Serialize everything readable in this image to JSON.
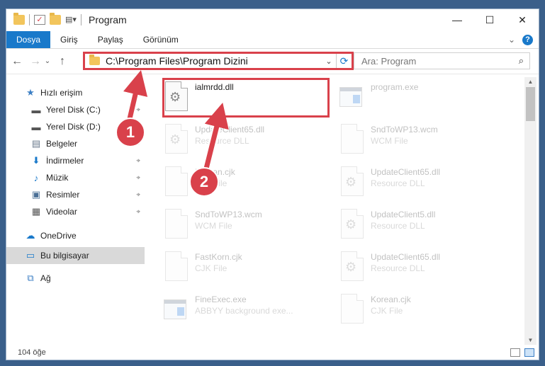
{
  "titlebar": {
    "title": "Program",
    "minimize": "—",
    "maximize": "☐",
    "close": "✕"
  },
  "ribbon": {
    "tabs": [
      "Dosya",
      "Giriş",
      "Paylaş",
      "Görünüm"
    ],
    "expand": "⌄",
    "help": "?"
  },
  "nav": {
    "back": "←",
    "forward": "→",
    "recent": "⌄",
    "up": "↑"
  },
  "address": {
    "path": "C:\\Program Files\\Program Dizini",
    "dropdown": "⌄",
    "refresh": "⟳"
  },
  "search": {
    "placeholder": "Ara: Program",
    "icon": "⌕"
  },
  "sidebar": {
    "items": [
      {
        "label": "Hızlı erişim",
        "icon": "star-icon",
        "glyph": "★",
        "color": "#3c7fc4"
      },
      {
        "label": "Yerel Disk (C:)",
        "icon": "drive-icon",
        "glyph": "▬",
        "color": "#555555",
        "pin": "⌖"
      },
      {
        "label": "Yerel Disk (D:)",
        "icon": "drive-icon",
        "glyph": "▬",
        "color": "#555555",
        "pin": "⌖"
      },
      {
        "label": "Belgeler",
        "icon": "documents-icon",
        "glyph": "▤",
        "color": "#6a7a8c",
        "pin": "⌖"
      },
      {
        "label": "İndirmeler",
        "icon": "downloads-icon",
        "glyph": "⬇",
        "color": "#1979ca",
        "pin": "⌖"
      },
      {
        "label": "Müzik",
        "icon": "music-icon",
        "glyph": "♪",
        "color": "#1979ca",
        "pin": "⌖"
      },
      {
        "label": "Resimler",
        "icon": "pictures-icon",
        "glyph": "▣",
        "color": "#4a6f96",
        "pin": "⌖"
      },
      {
        "label": "Videolar",
        "icon": "videos-icon",
        "glyph": "▦",
        "color": "#555555",
        "pin": "⌖"
      },
      {
        "label": "OneDrive",
        "icon": "cloud-icon",
        "glyph": "☁",
        "color": "#1979ca"
      },
      {
        "label": "Bu bilgisayar",
        "icon": "computer-icon",
        "glyph": "▭",
        "color": "#1979ca"
      },
      {
        "label": "Ağ",
        "icon": "network-icon",
        "glyph": "⧉",
        "color": "#3c7fc4"
      }
    ]
  },
  "files": [
    {
      "name": "ialmrdd.dll",
      "type": "",
      "kind": "dll",
      "faded": false
    },
    {
      "name": "program.exe",
      "type": "",
      "kind": "exe",
      "faded": true
    },
    {
      "name": "UpdateClient65.dll",
      "type": "Resource DLL",
      "kind": "dll",
      "faded": true
    },
    {
      "name": "SndToWP13.wcm",
      "type": "WCM File",
      "kind": "doc",
      "faded": true
    },
    {
      "name": "Korean.cjk",
      "type": "CJK File",
      "kind": "doc",
      "faded": true
    },
    {
      "name": "UpdateClient65.dll",
      "type": "Resource DLL",
      "kind": "dll",
      "faded": true
    },
    {
      "name": "SndToWP13.wcm",
      "type": "WCM File",
      "kind": "doc",
      "faded": true
    },
    {
      "name": "UpdateClient5.dll",
      "type": "Resource DLL",
      "kind": "dll",
      "faded": true
    },
    {
      "name": "FastKorn.cjk",
      "type": "CJK File",
      "kind": "doc",
      "faded": true
    },
    {
      "name": "UpdateClient65.dll",
      "type": "Resource DLL",
      "kind": "dll",
      "faded": true
    },
    {
      "name": "FineExec.exe",
      "type": "ABBYY background exe...",
      "kind": "exe",
      "faded": true
    },
    {
      "name": "Korean.cjk",
      "type": "CJK File",
      "kind": "doc",
      "faded": true
    }
  ],
  "status": {
    "count": "104 öğe"
  },
  "annotations": {
    "step1": "1",
    "step2": "2",
    "color": "#d9414b"
  }
}
